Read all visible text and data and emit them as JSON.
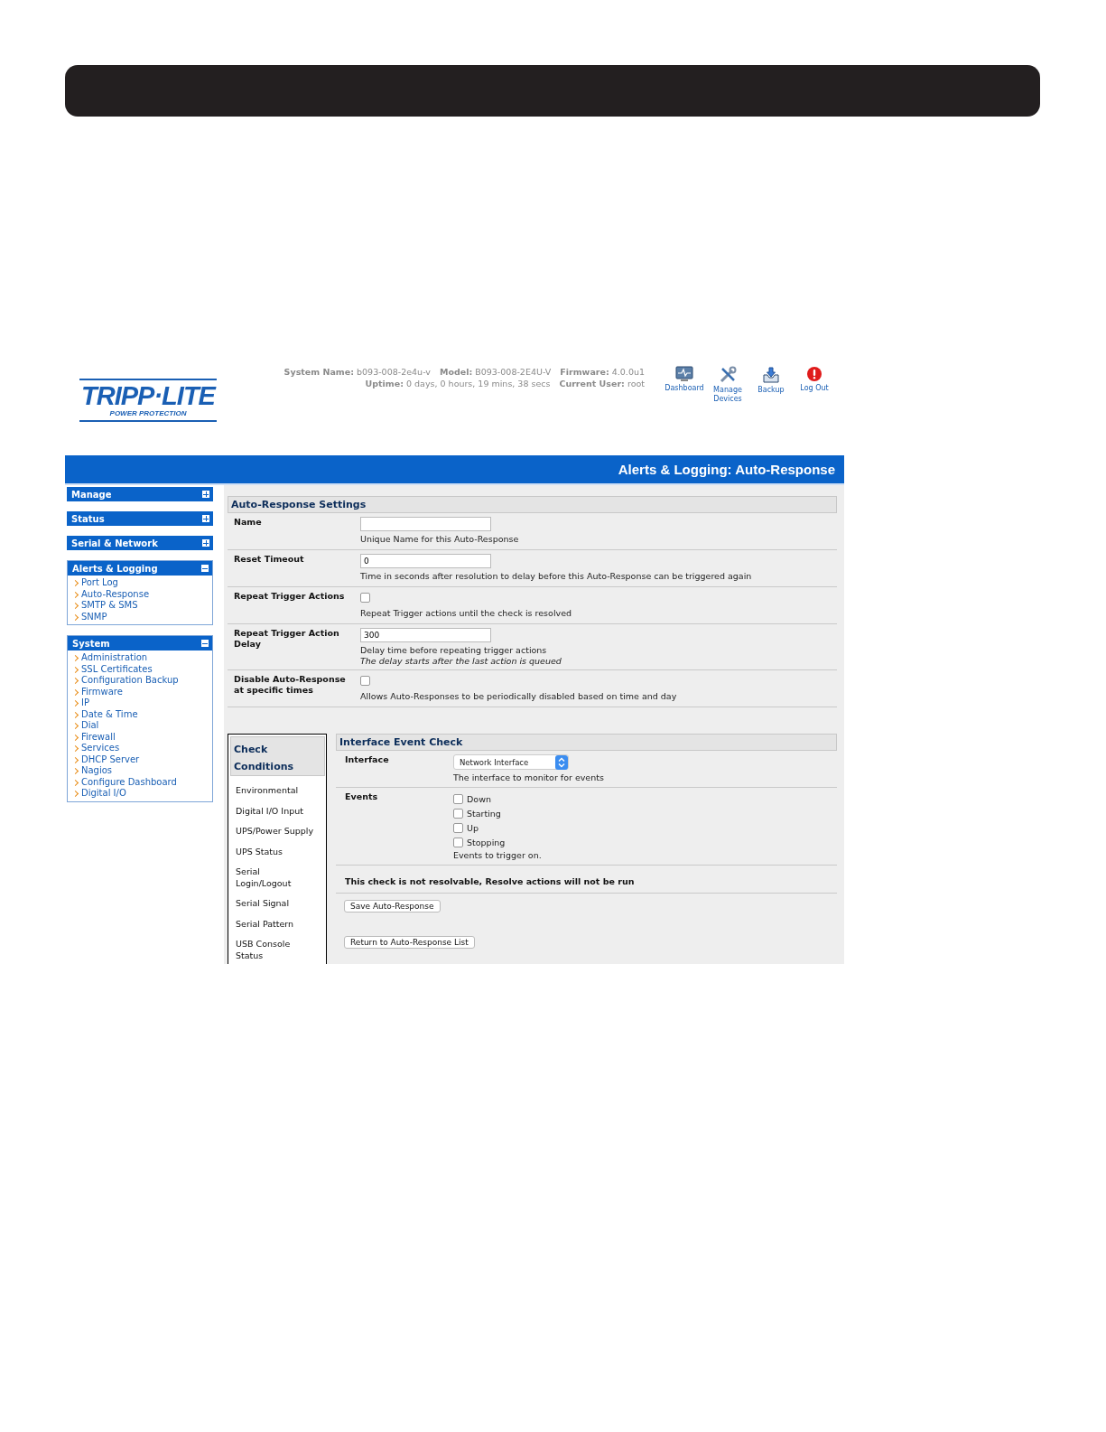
{
  "logo": {
    "name": "TRIPP·LITE",
    "tagline": "POWER PROTECTION"
  },
  "system_info": [
    [
      {
        "label": "System Name:",
        "value": "b093-008-2e4u-v"
      },
      {
        "label": "Model:",
        "value": "B093-008-2E4U-V"
      },
      {
        "label": "Firmware:",
        "value": "4.0.0u1"
      }
    ],
    [
      {
        "label": "Uptime:",
        "value": "0 days, 0 hours, 19 mins, 38 secs"
      },
      {
        "label": "Current User:",
        "value": "root"
      }
    ]
  ],
  "toolbar": [
    {
      "label": "Dashboard",
      "kind": "dashboard"
    },
    {
      "label": "Manage Devices",
      "kind": "manage"
    },
    {
      "label": "Backup",
      "kind": "backup"
    },
    {
      "label": "Log Out",
      "kind": "logout"
    }
  ],
  "page_title": "Alerts & Logging: Auto-Response",
  "sidebar": [
    {
      "title": "Manage",
      "expanded": false
    },
    {
      "title": "Status",
      "expanded": false
    },
    {
      "title": "Serial & Network",
      "expanded": false
    },
    {
      "title": "Alerts & Logging",
      "expanded": true,
      "items": [
        "Port Log",
        "Auto-Response",
        "SMTP & SMS",
        "SNMP"
      ]
    },
    {
      "title": "System",
      "expanded": true,
      "items": [
        "Administration",
        "SSL Certificates",
        "Configuration Backup",
        "Firmware",
        "IP",
        "Date & Time",
        "Dial",
        "Firewall",
        "Services",
        "DHCP Server",
        "Nagios",
        "Configure Dashboard",
        "Digital I/O"
      ]
    }
  ],
  "settings": {
    "title": "Auto-Response Settings",
    "rows": [
      {
        "label": "Name",
        "kind": "text",
        "value": "",
        "help": "Unique Name for this Auto-Response"
      },
      {
        "label": "Reset Timeout",
        "kind": "text",
        "value": "0",
        "help": "Time in seconds after resolution to delay before this Auto-Response can be triggered again"
      },
      {
        "label": "Repeat Trigger Actions",
        "kind": "checkbox",
        "checked": false,
        "help": "Repeat Trigger actions until the check is resolved"
      },
      {
        "label": "Repeat Trigger Action Delay",
        "kind": "text",
        "value": "300",
        "help": "Delay time before repeating trigger actions",
        "note": "The delay starts after the last action is queued"
      },
      {
        "label": "Disable Auto-Response at specific times",
        "kind": "checkbox",
        "checked": false,
        "help": "Allows Auto-Responses to be periodically disabled based on time and day"
      }
    ]
  },
  "check_conditions": {
    "title": "Check Conditions",
    "items": [
      "Environmental",
      "Digital I/O Input",
      "UPS/Power Supply",
      "UPS Status",
      "Serial Login/Logout",
      "Serial Signal",
      "Serial Pattern",
      "USB Console Status"
    ]
  },
  "interface_check": {
    "title": "Interface Event Check",
    "interface": {
      "label": "Interface",
      "value": "Network Interface",
      "help": "The interface to monitor for events"
    },
    "events": {
      "label": "Events",
      "options": [
        {
          "label": "Down",
          "checked": false
        },
        {
          "label": "Starting",
          "checked": false
        },
        {
          "label": "Up",
          "checked": false
        },
        {
          "label": "Stopping",
          "checked": false
        }
      ],
      "help": "Events to trigger on."
    },
    "notice": "This check is not resolvable, Resolve actions will not be run",
    "buttons": [
      "Save Auto-Response",
      "Return to Auto-Response List"
    ]
  }
}
